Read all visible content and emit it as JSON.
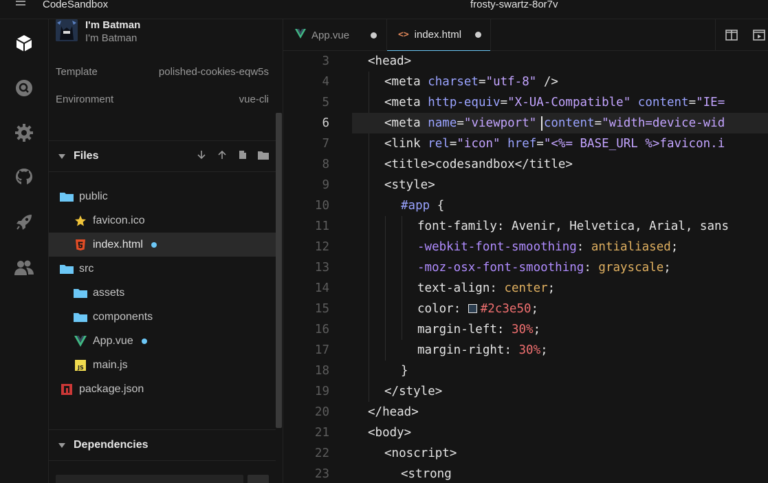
{
  "topbar": {
    "brand": "CodeSandbox",
    "sandbox_name": "frosty-swartz-8or7v"
  },
  "user": {
    "name": "I'm Batman",
    "subtitle": "I'm Batman"
  },
  "meta": [
    {
      "label": "Template",
      "value": "polished-cookies-eqw5s"
    },
    {
      "label": "Environment",
      "value": "vue-cli"
    }
  ],
  "files_section": {
    "title": "Files"
  },
  "tree": [
    {
      "name": "public",
      "icon": "folder-icon",
      "depth": 0
    },
    {
      "name": "favicon.ico",
      "icon": "star-icon",
      "depth": 1
    },
    {
      "name": "index.html",
      "icon": "html5-icon",
      "depth": 1,
      "active": true,
      "modified": true
    },
    {
      "name": "src",
      "icon": "folder-icon",
      "depth": 0
    },
    {
      "name": "assets",
      "icon": "folder-icon",
      "depth": 1
    },
    {
      "name": "components",
      "icon": "folder-icon",
      "depth": 1
    },
    {
      "name": "App.vue",
      "icon": "vue-icon",
      "depth": 1,
      "modified": true
    },
    {
      "name": "main.js",
      "icon": "js-icon",
      "depth": 1
    },
    {
      "name": "package.json",
      "icon": "npm-icon",
      "depth": 0
    }
  ],
  "dependencies_section": {
    "title": "Dependencies"
  },
  "tabs": [
    {
      "label": "App.vue",
      "icon": "vue-icon",
      "modified": true
    },
    {
      "label": "index.html",
      "icon": "code-icon",
      "modified": true,
      "active": true
    }
  ],
  "code": {
    "current_line": 6,
    "lines": [
      {
        "n": "3",
        "text": "<head>"
      },
      {
        "n": "4",
        "text": "<meta charset=\"utf-8\" />"
      },
      {
        "n": "5",
        "text": "<meta http-equiv=\"X-UA-Compatible\" content=\"IE="
      },
      {
        "n": "6",
        "text": "<meta name=\"viewport\" content=\"width=device-wid"
      },
      {
        "n": "7",
        "text": "<link rel=\"icon\" href=\"<%= BASE_URL %>favicon.i"
      },
      {
        "n": "8",
        "text": "<title>codesandbox</title>"
      },
      {
        "n": "9",
        "text": "<style>"
      },
      {
        "n": "10",
        "text": "#app {"
      },
      {
        "n": "11",
        "text": "font-family: Avenir, Helvetica, Arial, sans"
      },
      {
        "n": "12",
        "text": "-webkit-font-smoothing: antialiased;"
      },
      {
        "n": "13",
        "text": "-moz-osx-font-smoothing: grayscale;"
      },
      {
        "n": "14",
        "text": "text-align: center;"
      },
      {
        "n": "15",
        "text": "color: #2c3e50;"
      },
      {
        "n": "16",
        "text": "margin-left: 30%;"
      },
      {
        "n": "17",
        "text": "margin-right: 30%;"
      },
      {
        "n": "18",
        "text": "}"
      },
      {
        "n": "19",
        "text": "</style>"
      },
      {
        "n": "20",
        "text": "</head>"
      },
      {
        "n": "21",
        "text": "<body>"
      },
      {
        "n": "22",
        "text": "<noscript>"
      },
      {
        "n": "23",
        "text": "<strong"
      }
    ]
  },
  "colors": {
    "accent": "#6cc7f6",
    "folder": "#6cc7f6",
    "vue": "#41b883",
    "html5": "#e44d26",
    "npm": "#cb3837",
    "js": "#f0db4f"
  }
}
